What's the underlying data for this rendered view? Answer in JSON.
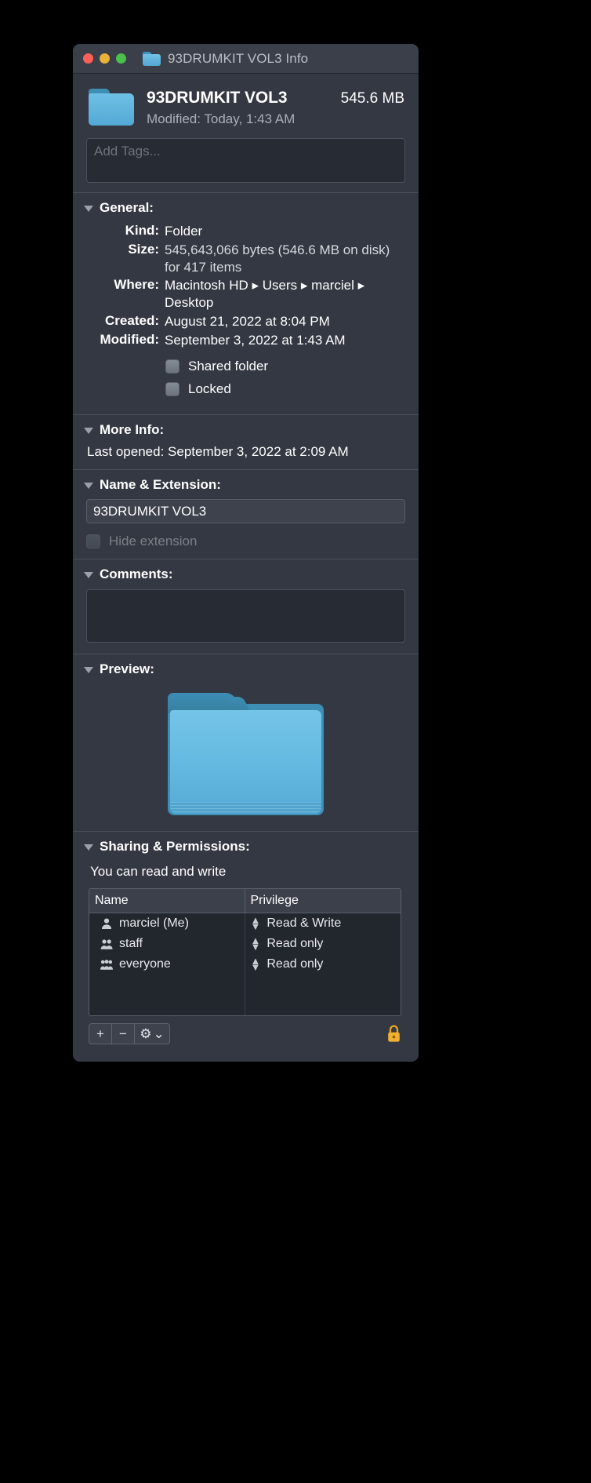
{
  "window": {
    "title": "93DRUMKIT VOL3 Info",
    "traffic_lights": [
      "close",
      "minimize",
      "zoom"
    ]
  },
  "header": {
    "name": "93DRUMKIT VOL3",
    "size": "545.6 MB",
    "modified": "Modified: Today, 1:43 AM"
  },
  "tags": {
    "placeholder": "Add Tags..."
  },
  "general": {
    "title": "General:",
    "rows": [
      {
        "label": "Kind:",
        "value": "Folder"
      },
      {
        "label": "Size:",
        "value": "545,643,066 bytes (546.6 MB on disk) for 417 items"
      },
      {
        "label": "Where:",
        "value": "Macintosh HD ▸ Users ▸ marciel ▸ Desktop"
      },
      {
        "label": "Created:",
        "value": "August 21, 2022 at 8:04 PM"
      },
      {
        "label": "Modified:",
        "value": "September 3, 2022 at 1:43 AM"
      }
    ],
    "checkboxes": [
      {
        "label": "Shared folder",
        "checked": false
      },
      {
        "label": "Locked",
        "checked": false
      }
    ]
  },
  "more_info": {
    "title": "More Info:",
    "label": "Last opened:",
    "value": "September 3, 2022 at 2:09 AM"
  },
  "name_extension": {
    "title": "Name & Extension:",
    "value": "93DRUMKIT VOL3",
    "hide_extension_label": "Hide extension",
    "hide_extension_checked": false
  },
  "comments": {
    "title": "Comments:",
    "value": ""
  },
  "preview": {
    "title": "Preview:",
    "icon": "folder-icon"
  },
  "sharing": {
    "title": "Sharing & Permissions:",
    "note": "You can read and write",
    "columns": [
      "Name",
      "Privilege"
    ],
    "rows": [
      {
        "icon": "single-user-icon",
        "name": "marciel (Me)",
        "privilege": "Read & Write"
      },
      {
        "icon": "two-users-icon",
        "name": "staff",
        "privilege": "Read only"
      },
      {
        "icon": "three-users-icon",
        "name": "everyone",
        "privilege": "Read only"
      }
    ],
    "toolbar": {
      "add_label": "+",
      "remove_label": "−",
      "action_label": "⚙",
      "action_chevron": "⌄",
      "lock_state": "locked"
    }
  },
  "colors": {
    "window_bg": "#333842",
    "titlebar_bg": "#3a3f4a",
    "folder_blue": "#5fb3dd",
    "lock_orange": "#f0a020",
    "close_red": "#ff5f57",
    "min_yellow": "#e7b13a",
    "zoom_green": "#4ac14a"
  }
}
